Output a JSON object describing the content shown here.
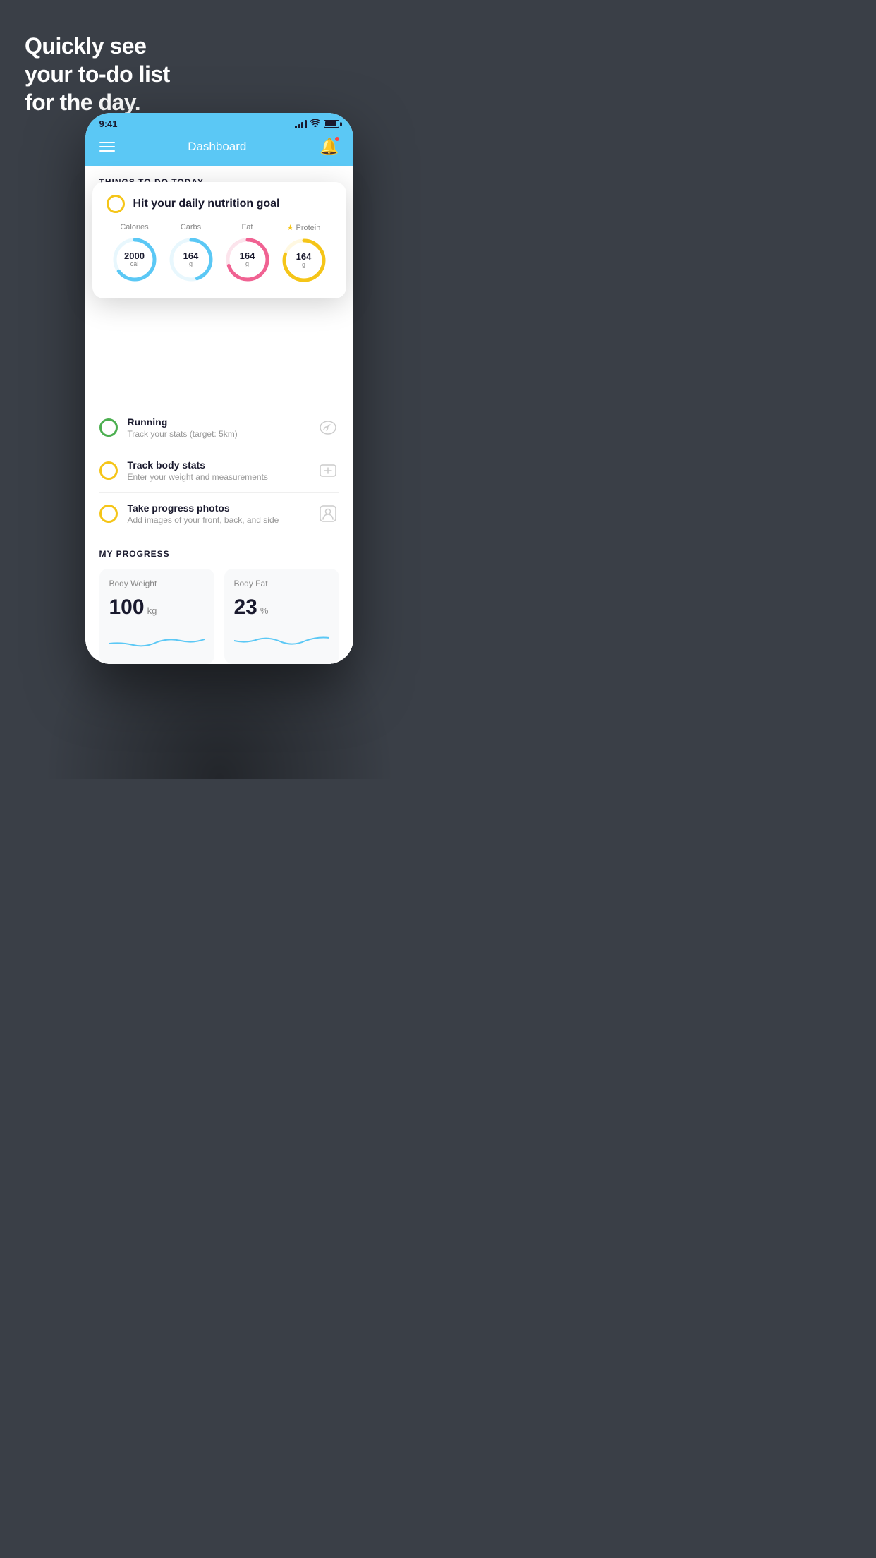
{
  "hero": {
    "line1": "Quickly see",
    "line2": "your to-do list",
    "line3": "for the day."
  },
  "status_bar": {
    "time": "9:41"
  },
  "header": {
    "title": "Dashboard"
  },
  "things_section": {
    "label": "THINGS TO DO TODAY"
  },
  "nutrition_card": {
    "title": "Hit your daily nutrition goal",
    "items": [
      {
        "label": "Calories",
        "value": "2000",
        "unit": "cal",
        "color": "#5bc8f5",
        "bg_color": "#e8f7fd",
        "progress": 0.65
      },
      {
        "label": "Carbs",
        "value": "164",
        "unit": "g",
        "color": "#5bc8f5",
        "bg_color": "#e8f7fd",
        "progress": 0.45
      },
      {
        "label": "Fat",
        "value": "164",
        "unit": "g",
        "color": "#f06292",
        "bg_color": "#fce4ec",
        "progress": 0.7
      },
      {
        "label": "Protein",
        "value": "164",
        "unit": "g",
        "color": "#f5c518",
        "bg_color": "#fff8e1",
        "progress": 0.8,
        "starred": true
      }
    ]
  },
  "todo_items": [
    {
      "id": "running",
      "title": "Running",
      "subtitle": "Track your stats (target: 5km)",
      "circle_color": "green",
      "icon": "👟"
    },
    {
      "id": "body-stats",
      "title": "Track body stats",
      "subtitle": "Enter your weight and measurements",
      "circle_color": "yellow",
      "icon": "⚖️"
    },
    {
      "id": "progress-photos",
      "title": "Take progress photos",
      "subtitle": "Add images of your front, back, and side",
      "circle_color": "yellow",
      "icon": "👤"
    }
  ],
  "progress_section": {
    "label": "MY PROGRESS",
    "cards": [
      {
        "id": "body-weight",
        "title": "Body Weight",
        "value": "100",
        "unit": "kg"
      },
      {
        "id": "body-fat",
        "title": "Body Fat",
        "value": "23",
        "unit": "%"
      }
    ]
  }
}
